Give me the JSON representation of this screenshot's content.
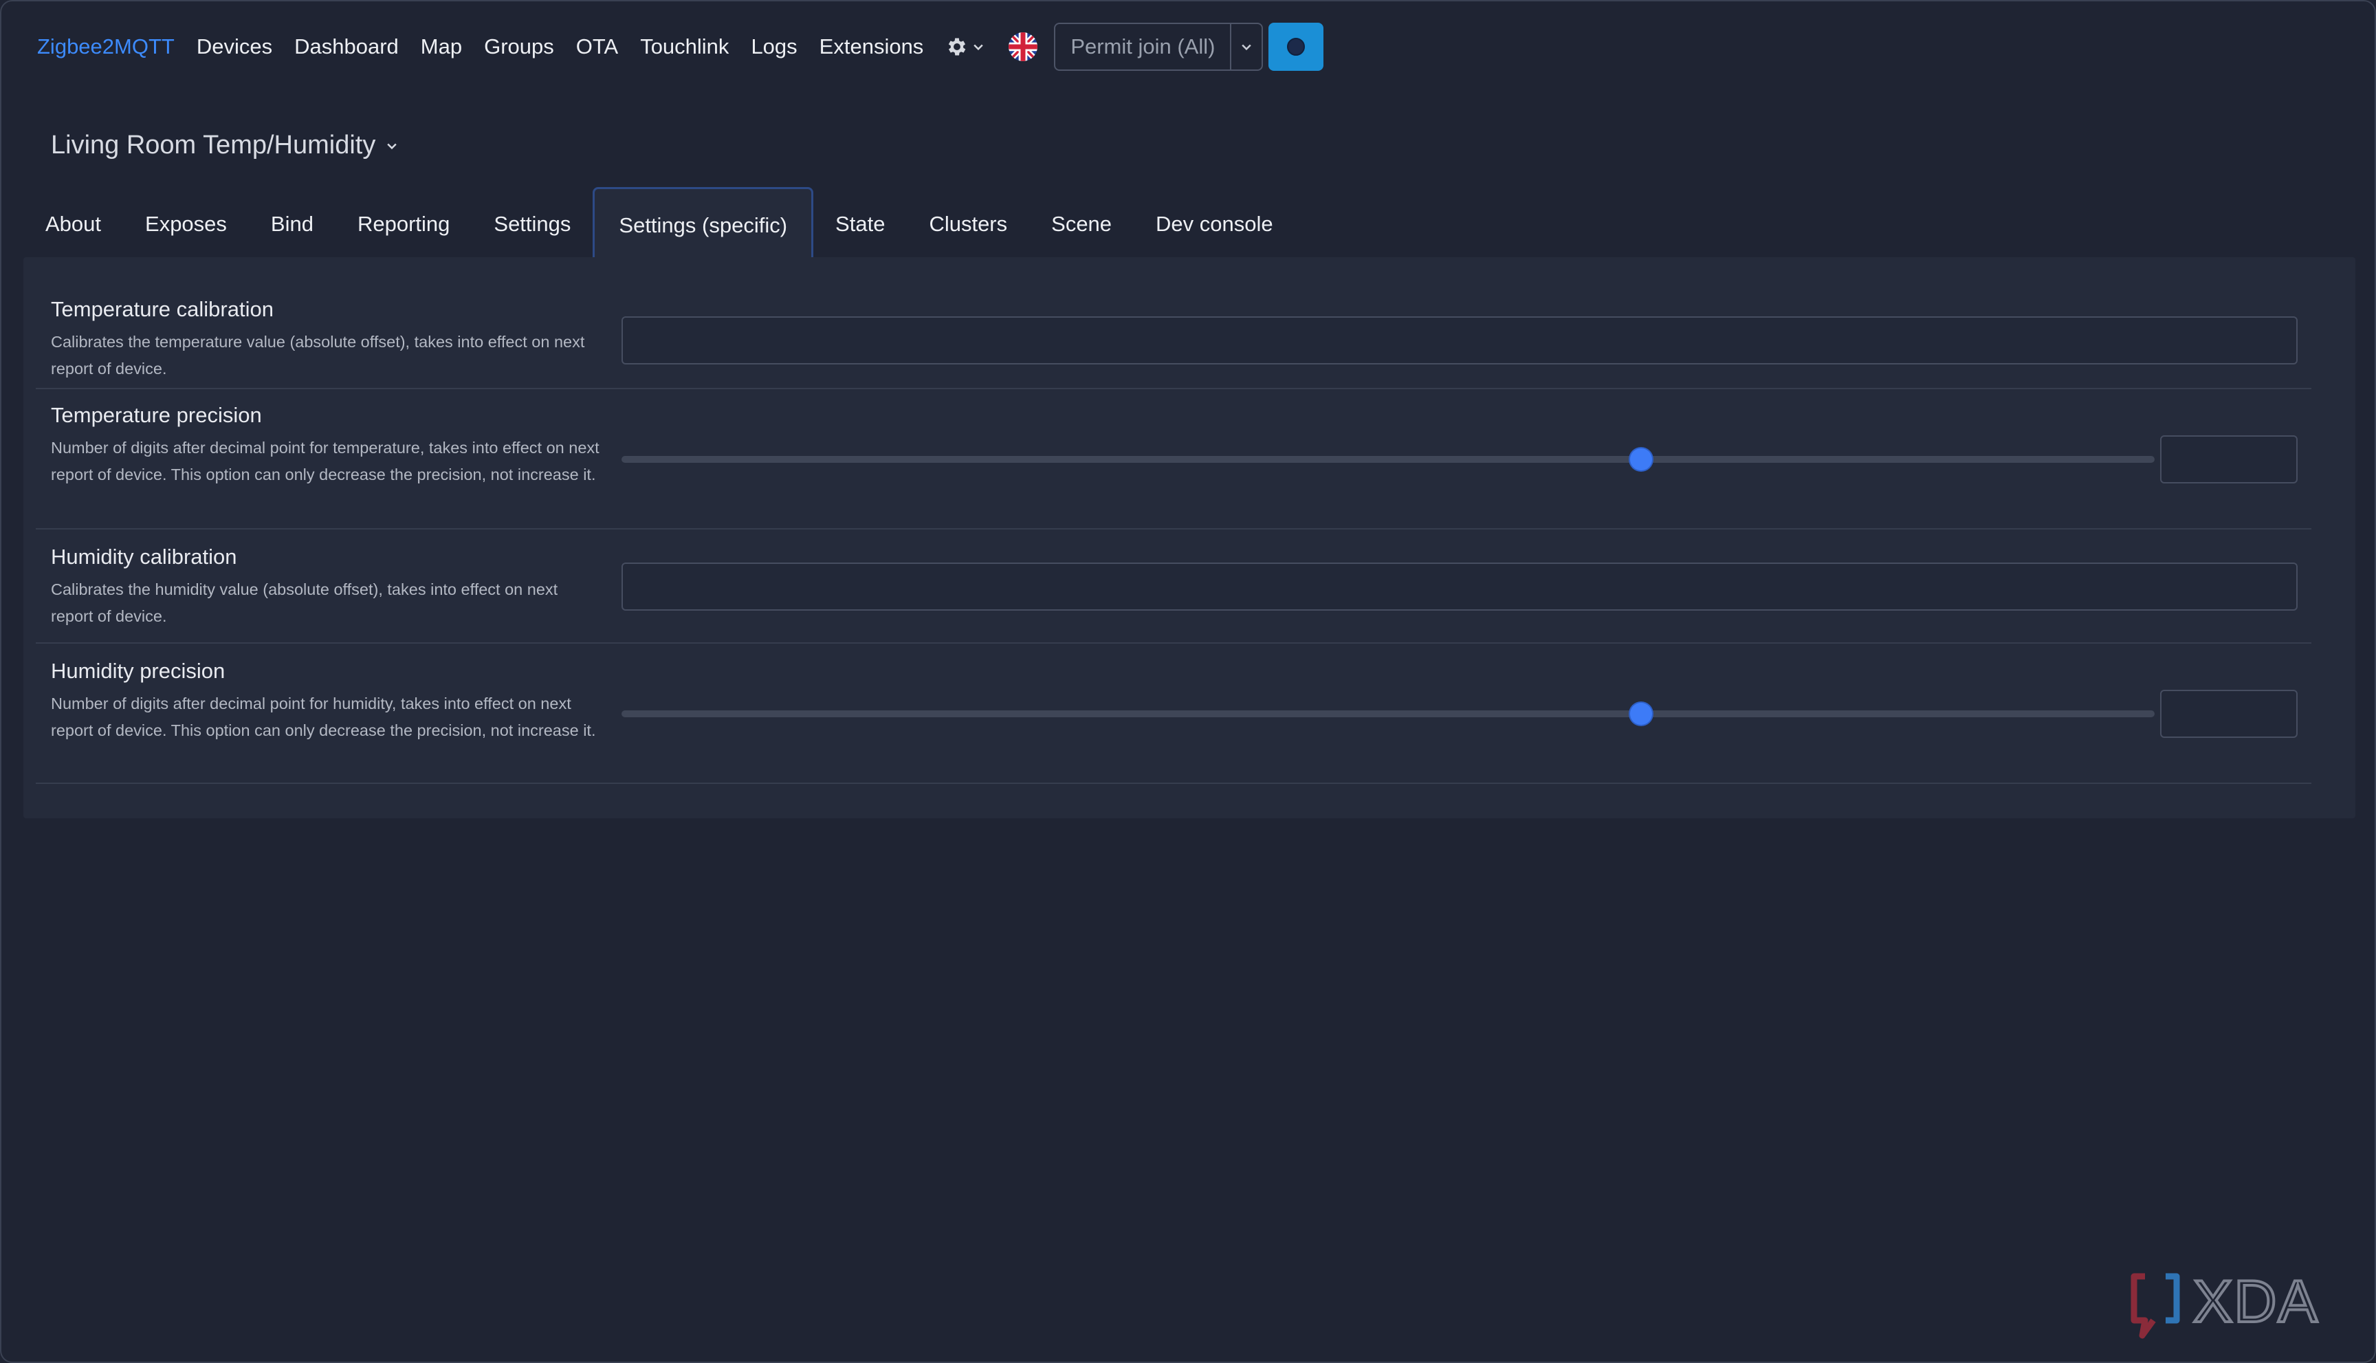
{
  "navbar": {
    "brand": "Zigbee2MQTT",
    "items": [
      "Devices",
      "Dashboard",
      "Map",
      "Groups",
      "OTA",
      "Touchlink",
      "Logs",
      "Extensions"
    ],
    "settings_icon": "gear-icon",
    "language_icon": "uk-flag-icon",
    "permit_join_label": "Permit join (All)",
    "status_icon": "status-dot-icon",
    "accent_color": "#3d8bfd",
    "status_button_color": "#1b8fd6"
  },
  "device": {
    "name": "Living Room Temp/Humidity"
  },
  "tabs": [
    {
      "label": "About"
    },
    {
      "label": "Exposes"
    },
    {
      "label": "Bind"
    },
    {
      "label": "Reporting"
    },
    {
      "label": "Settings"
    },
    {
      "label": "Settings (specific)",
      "active": true
    },
    {
      "label": "State"
    },
    {
      "label": "Clusters"
    },
    {
      "label": "Scene"
    },
    {
      "label": "Dev console"
    }
  ],
  "settings": {
    "temperature_calibration": {
      "title": "Temperature calibration",
      "description": "Calibrates the temperature value (absolute offset), takes into effect on next report of device.",
      "value": ""
    },
    "temperature_precision": {
      "title": "Temperature precision",
      "description": "Number of digits after decimal point for temperature, takes into effect on next report of device. This option can only decrease the precision, not increase it.",
      "slider_fraction": 0.665,
      "value": ""
    },
    "humidity_calibration": {
      "title": "Humidity calibration",
      "description": "Calibrates the humidity value (absolute offset), takes into effect on next report of device.",
      "value": ""
    },
    "humidity_precision": {
      "title": "Humidity precision",
      "description": "Number of digits after decimal point for humidity, takes into effect on next report of device. This option can only decrease the precision, not increase it.",
      "slider_fraction": 0.665,
      "value": ""
    }
  },
  "watermark": {
    "text": "XDA"
  }
}
